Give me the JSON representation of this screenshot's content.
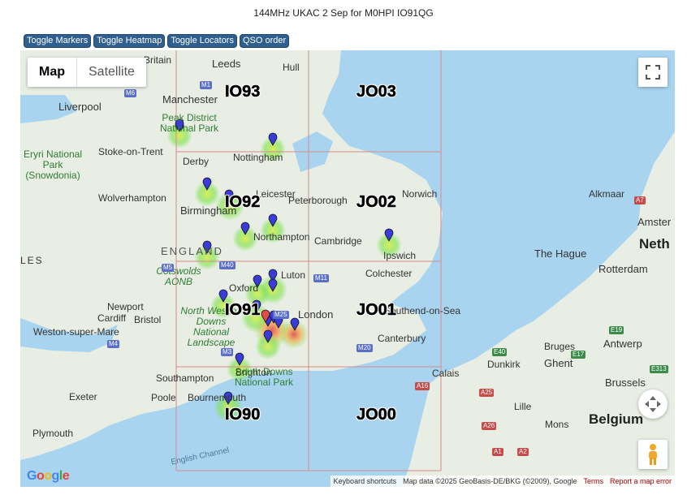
{
  "title": "144MHz UKAC 2 Sep for M0HPI IO91QG",
  "toolbar": {
    "toggle_markers": "Toggle Markers",
    "toggle_heatmap": "Toggle Heatmap",
    "toggle_locators": "Toggle Locators",
    "qso_order": "QSO order"
  },
  "map": {
    "map_type_map": "Map",
    "map_type_satellite": "Satellite",
    "attribution": {
      "keyboard": "Keyboard shortcuts",
      "data": "Map data ©2025 GeoBasis-DE/BKG (©2009), Google",
      "terms": "Terms",
      "report": "Report a map error"
    },
    "google_logo": "Google",
    "locators": [
      "IO93",
      "JO03",
      "IO92",
      "JO02",
      "IO91",
      "JO01",
      "IO90",
      "JO00"
    ],
    "places": {
      "britain": "Britain",
      "leeds": "Leeds",
      "hull": "Hull",
      "manchester": "Manchester",
      "liverpool": "Liverpool",
      "stoke": "Stoke-on-Trent",
      "derby": "Derby",
      "nottingham": "Nottingham",
      "wolverhampton": "Wolverhampton",
      "leicester": "Leicester",
      "peterborough": "Peterborough",
      "norwich": "Norwich",
      "birmingham": "Birmingham",
      "northampton": "Northampton",
      "cambridge": "Cambridge",
      "ipswich": "Ipswich",
      "luton": "Luton",
      "colchester": "Colchester",
      "oxford": "Oxford",
      "london": "London",
      "southend": "Southend-on-Sea",
      "newport": "Newport",
      "cardiff": "Cardiff",
      "bristol": "Bristol",
      "weston": "Weston-super-Mare",
      "canterbury": "Canterbury",
      "southampton": "Southampton",
      "brighton": "Brighton",
      "exeter": "Exeter",
      "poole": "Poole",
      "bournemouth": "Bournemouth",
      "plymouth": "Plymouth",
      "calais": "Calais",
      "dunkirk": "Dunkirk",
      "bruges": "Bruges",
      "ghent": "Ghent",
      "antwerp": "Antwerp",
      "brussels": "Brussels",
      "lille": "Lille",
      "mons": "Mons",
      "alkmaar": "Alkmaar",
      "amsterdam": "Amster",
      "hague": "The Hague",
      "rotterdam": "Rotterdam",
      "les": "LES"
    },
    "countries": {
      "england": "ENGLAND",
      "belgium": "Belgium",
      "netherlands": "Neth"
    },
    "parks": {
      "peak": "Peak District National Park",
      "eryri": "Eryri National Park (Snowdonia)",
      "cotswolds": "Cotswolds AONB",
      "nwessex": "North Wessex Downs National Landscape",
      "southdowns": "South Downs National Park"
    },
    "sea": {
      "channel": "English Channel"
    },
    "roads": [
      "M6",
      "M1",
      "M5",
      "M40",
      "M11",
      "M25",
      "M3",
      "M20",
      "M4",
      "A16",
      "A25",
      "A26",
      "A1",
      "A2",
      "E40",
      "E17",
      "E19",
      "E313",
      "A7"
    ],
    "colors": {
      "land": "#e8eee4",
      "water": "#a8d4f0",
      "grid": "#d98a8a",
      "marker": "#3b3bd9",
      "heat_low": "#7be24a",
      "heat_high": "#e24a4a"
    }
  }
}
